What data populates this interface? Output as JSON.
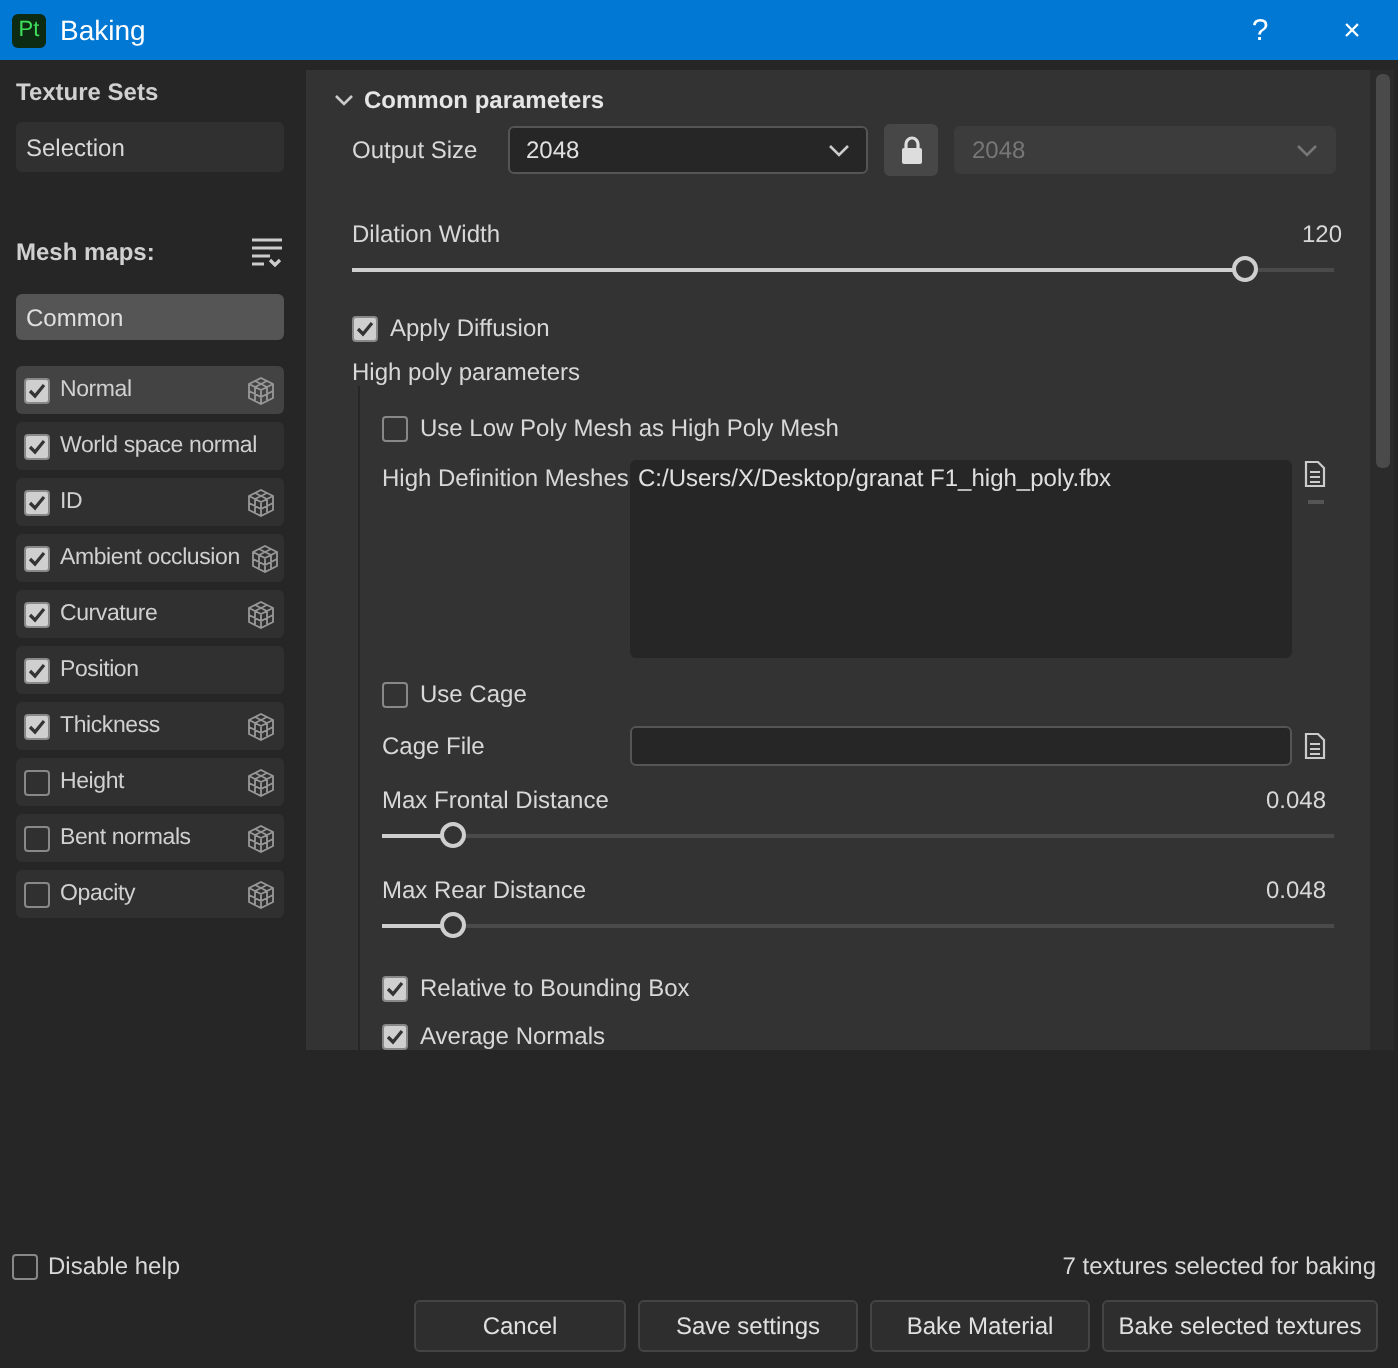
{
  "window": {
    "app_badge": "Pt",
    "title": "Baking",
    "help": "?",
    "close": "×"
  },
  "texture_sets": {
    "title": "Texture Sets",
    "value": "Selection"
  },
  "mesh_maps": {
    "title": "Mesh maps:",
    "group": "Common",
    "items": [
      {
        "label": "Normal",
        "checked": true,
        "selected": true,
        "cube_icon": true
      },
      {
        "label": "World space normal",
        "checked": true,
        "selected": false,
        "cube_icon": false
      },
      {
        "label": "ID",
        "checked": true,
        "selected": false,
        "cube_icon": true
      },
      {
        "label": "Ambient occlusion",
        "checked": true,
        "selected": false,
        "cube_icon": true
      },
      {
        "label": "Curvature",
        "checked": true,
        "selected": false,
        "cube_icon": true
      },
      {
        "label": "Position",
        "checked": true,
        "selected": false,
        "cube_icon": false
      },
      {
        "label": "Thickness",
        "checked": true,
        "selected": false,
        "cube_icon": true
      },
      {
        "label": "Height",
        "checked": false,
        "selected": false,
        "cube_icon": true
      },
      {
        "label": "Bent normals",
        "checked": false,
        "selected": false,
        "cube_icon": true
      },
      {
        "label": "Opacity",
        "checked": false,
        "selected": false,
        "cube_icon": true
      }
    ]
  },
  "common": {
    "title": "Common parameters",
    "expanded": true,
    "output_size": {
      "label": "Output Size",
      "value": "2048",
      "locked": true,
      "linked_value": "2048"
    },
    "dilation": {
      "label": "Dilation Width",
      "reading": "120",
      "level": 0.92
    },
    "apply_diffusion": {
      "label": "Apply Diffusion",
      "checked": true
    },
    "high_poly_title": "High poly parameters",
    "use_low_poly": {
      "label": "Use Low Poly Mesh as High Poly Mesh",
      "checked": false
    },
    "meshes": {
      "label": "High Definition Meshes",
      "value": "C:/Users/X/Desktop/granat F1_high_poly.fbx"
    },
    "use_cage": {
      "label": "Use Cage",
      "checked": false
    },
    "cage_file": {
      "label": "Cage File"
    },
    "distances": [
      {
        "label": "Max Frontal Distance",
        "reading": "0.048",
        "level": 0.06
      },
      {
        "label": "Max Rear Distance",
        "reading": "0.048",
        "level": 0.06
      }
    ],
    "options": [
      {
        "label": "Relative to Bounding Box",
        "checked": true
      },
      {
        "label": "Average Normals",
        "checked": true
      }
    ]
  },
  "footer": {
    "disable_help": {
      "label": "Disable help",
      "checked": false
    },
    "status": "7 textures selected for baking",
    "buttons": [
      "Cancel",
      "Save settings",
      "Bake Material",
      "Bake selected textures"
    ]
  }
}
